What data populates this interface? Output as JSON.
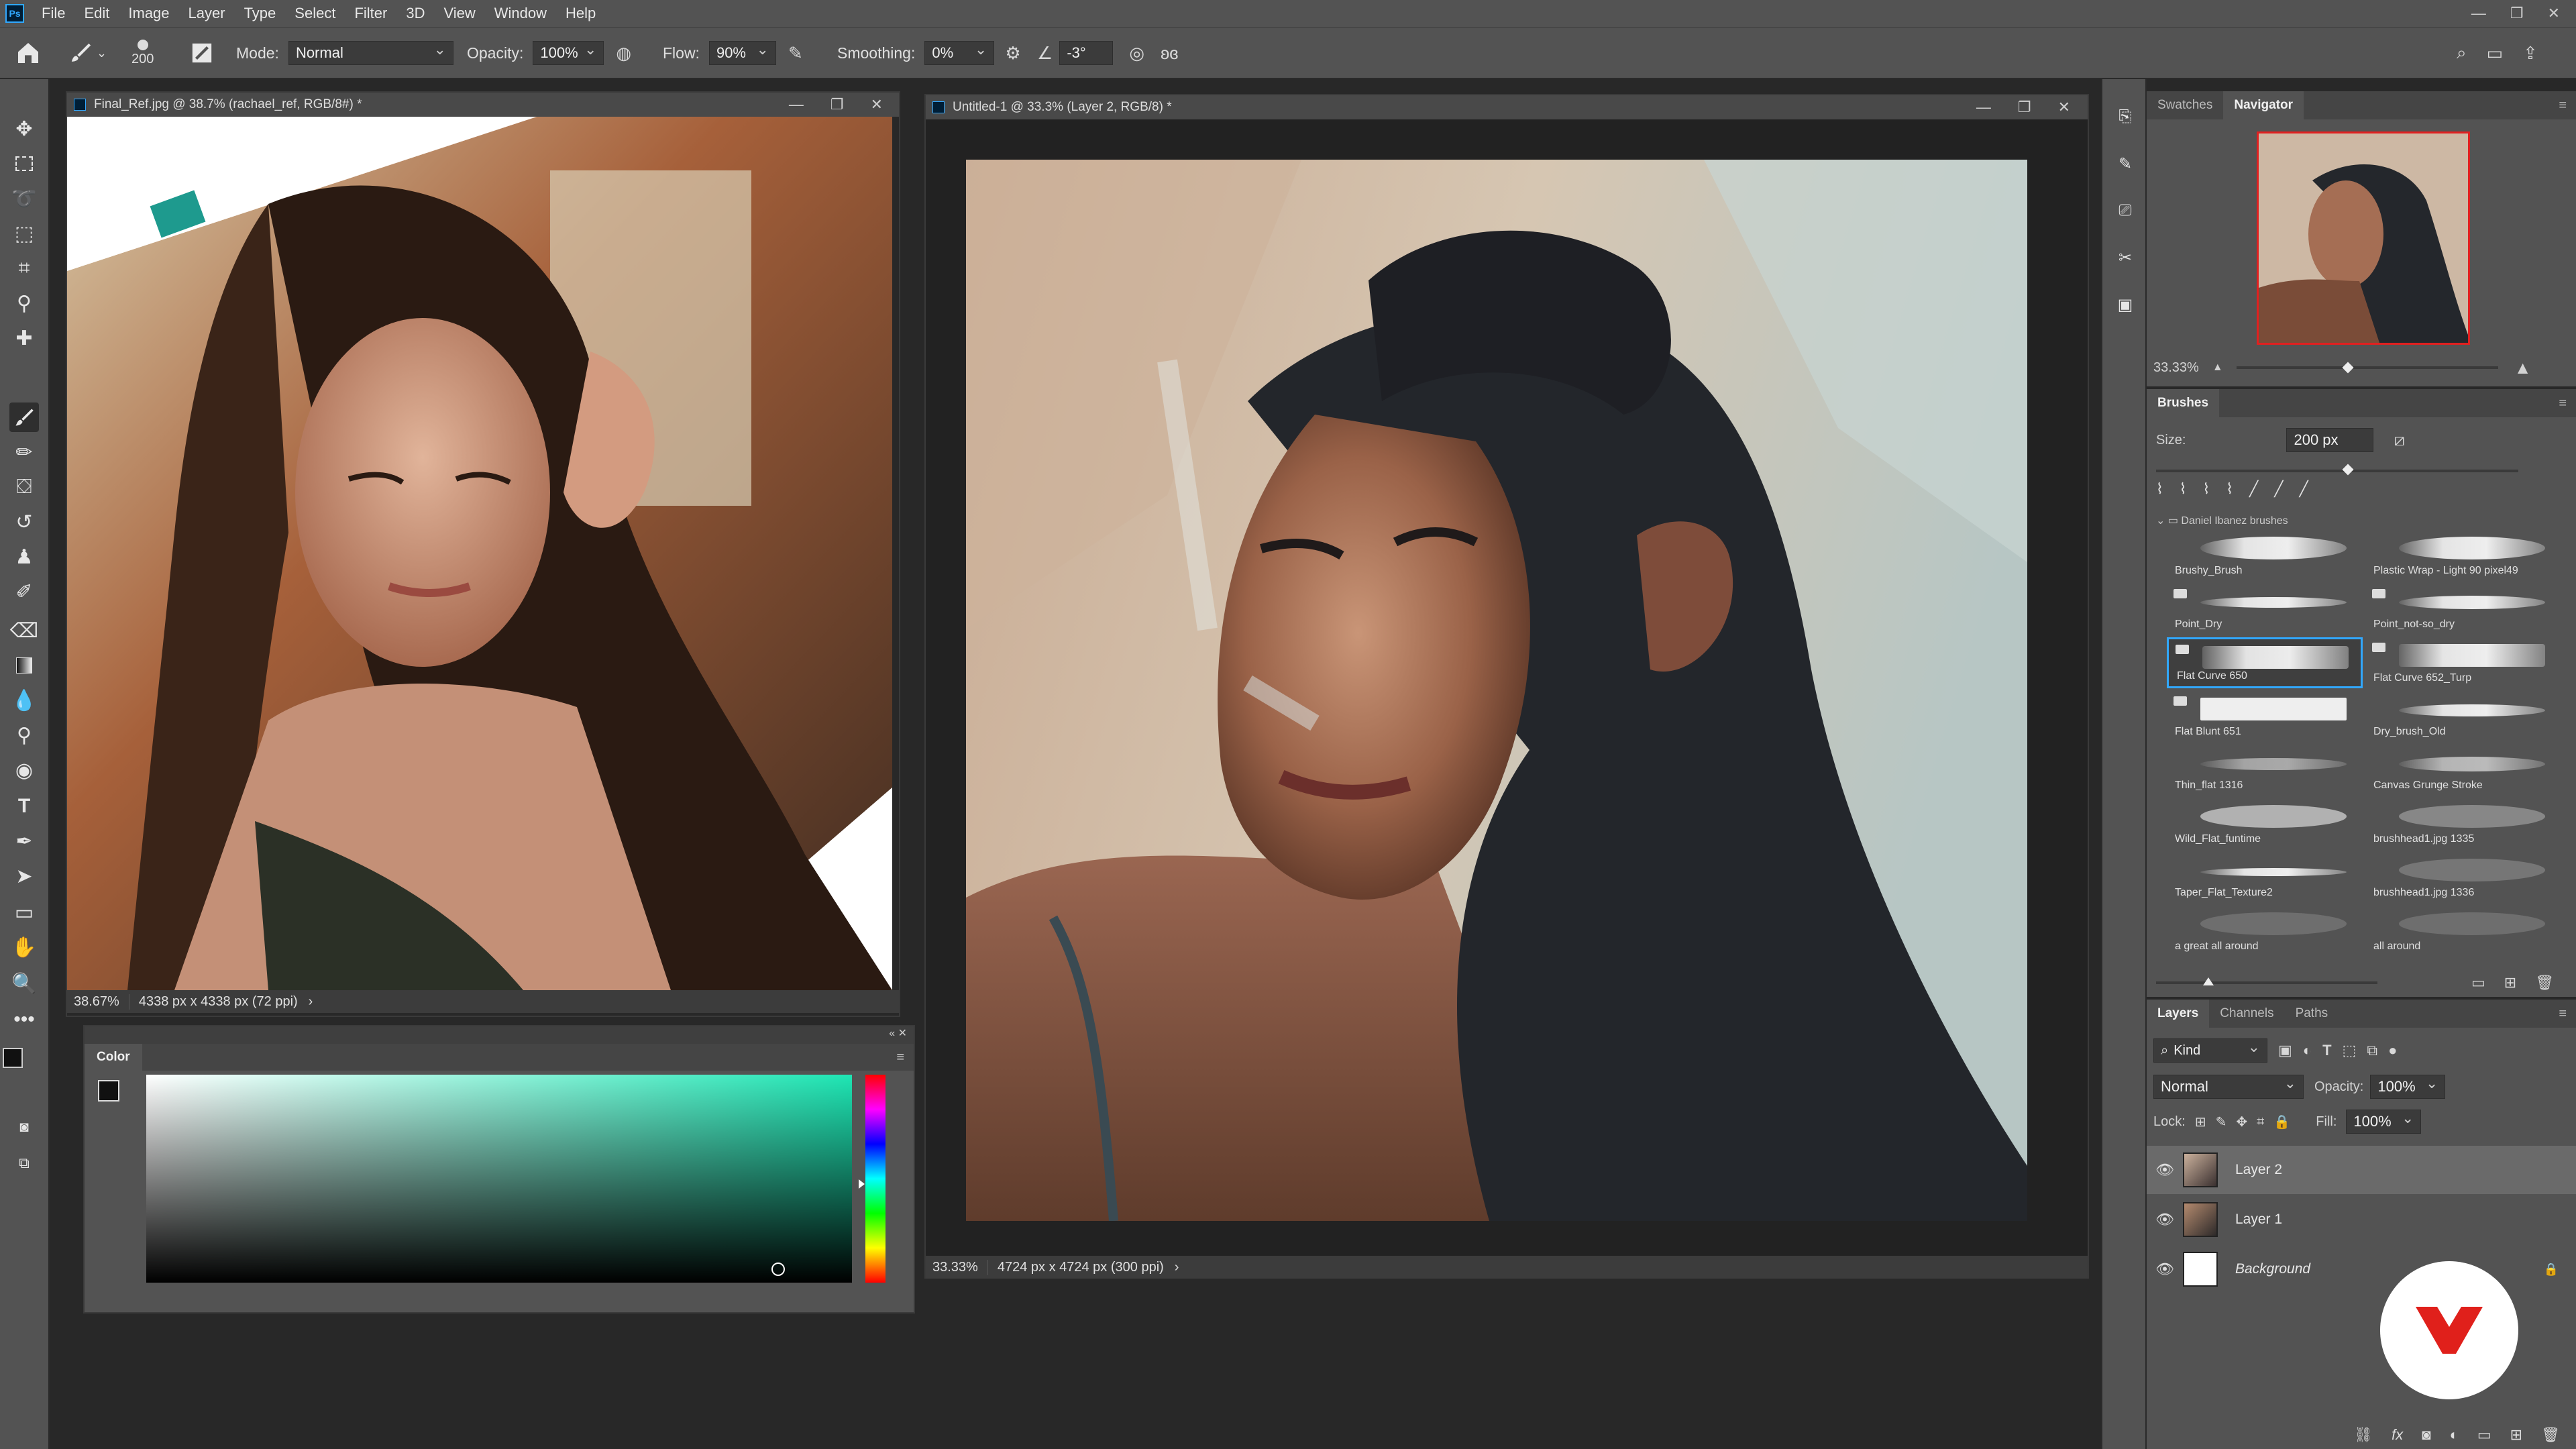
{
  "app": {
    "logo": "Ps"
  },
  "menu": [
    "File",
    "Edit",
    "Image",
    "Layer",
    "Type",
    "Select",
    "Filter",
    "3D",
    "View",
    "Window",
    "Help"
  ],
  "window_controls": {
    "minimize": "—",
    "restore": "❐",
    "close": "✕"
  },
  "options": {
    "brush_size": "200",
    "mode_label": "Mode:",
    "mode_value": "Normal",
    "opacity_label": "Opacity:",
    "opacity_value": "100%",
    "flow_label": "Flow:",
    "flow_value": "90%",
    "smoothing_label": "Smoothing:",
    "smoothing_value": "0%",
    "angle_value": "-3°"
  },
  "doc1": {
    "title": "Final_Ref.jpg @ 38.7% (rachael_ref, RGB/8#) *",
    "zoom": "38.67%",
    "info": "4338 px x 4338 px (72 ppi)"
  },
  "doc2": {
    "title": "Untitled-1 @ 33.3% (Layer 2, RGB/8) *",
    "zoom": "33.33%",
    "info": "4724 px x 4724 px (300 ppi)"
  },
  "color_panel": {
    "title": "Color"
  },
  "navigator": {
    "tab_swatches": "Swatches",
    "tab_navigator": "Navigator",
    "zoom": "33.33%"
  },
  "brushes": {
    "title": "Brushes",
    "size_label": "Size:",
    "size_value": "200 px",
    "group_name": "Daniel Ibanez brushes",
    "items": [
      "Brushy_Brush",
      "Plastic Wrap - Light 90 pixel49",
      "Point_Dry",
      "Point_not-so_dry",
      "Flat Curve 650",
      "Flat Curve 652_Turp",
      "Flat Blunt 651",
      "Dry_brush_Old",
      "Thin_flat 1316",
      "Canvas Grunge Stroke",
      "Wild_Flat_funtime",
      "brushhead1.jpg 1335",
      "Taper_Flat_Texture2",
      "brushhead1.jpg 1336",
      "a great all around",
      "all around"
    ],
    "selected_index": 4
  },
  "layers_panel": {
    "tabs": [
      "Layers",
      "Channels",
      "Paths"
    ],
    "filter_kind": "Kind",
    "blend_mode": "Normal",
    "opacity_label": "Opacity:",
    "opacity_value": "100%",
    "lock_label": "Lock:",
    "fill_label": "Fill:",
    "fill_value": "100%",
    "layers": [
      "Layer 2",
      "Layer 1",
      "Background"
    ],
    "selected_layer": "Layer 2"
  },
  "colors": {
    "accent": "#31a8ff",
    "badge": "#e0201b"
  }
}
